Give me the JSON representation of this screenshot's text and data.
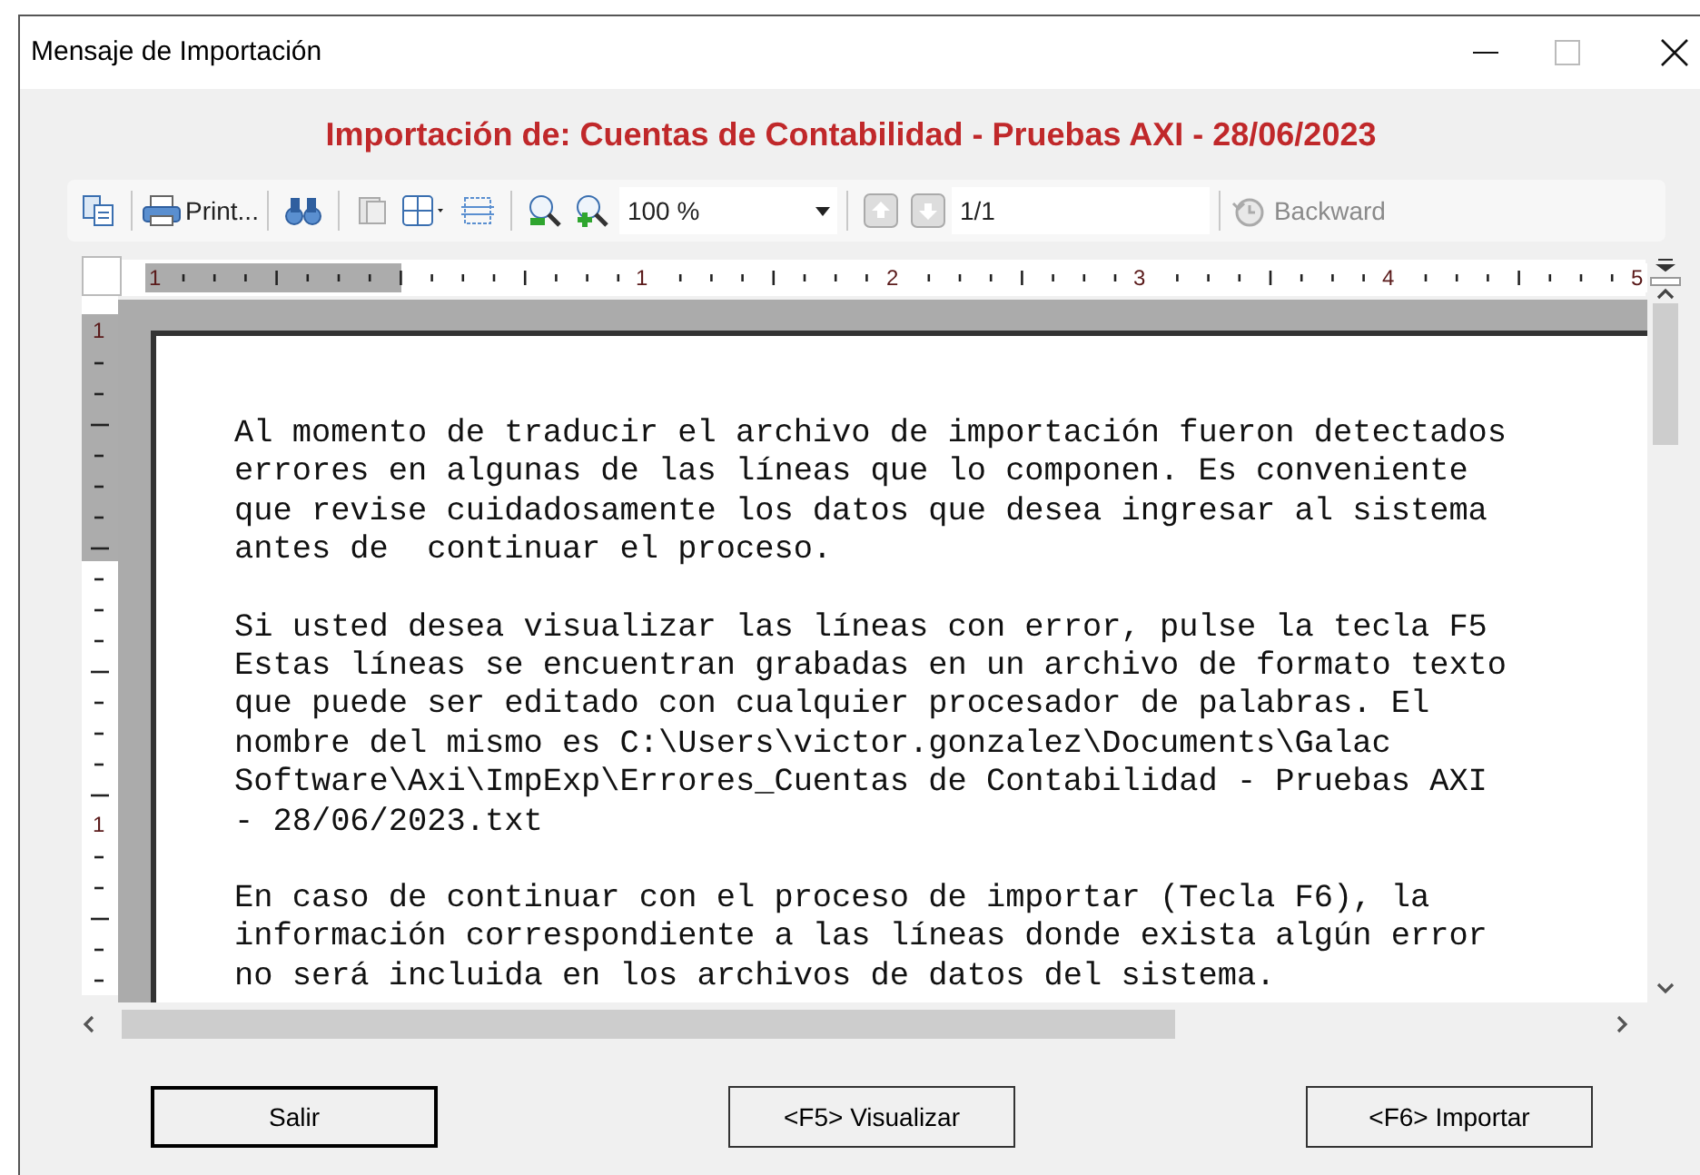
{
  "window": {
    "title": "Mensaje de Importación"
  },
  "heading": "Importación de: Cuentas de Contabilidad - Pruebas AXI - 28/06/2023",
  "toolbar": {
    "print_label": "Print...",
    "zoom": "100 %",
    "page": "1/1",
    "backward": {
      "label": "Backward",
      "disabled": true
    }
  },
  "ruler": {
    "horizontal_labels": [
      "1",
      "1",
      "2",
      "3",
      "4",
      "5"
    ],
    "vertical_labels": [
      "1",
      "1"
    ]
  },
  "document": {
    "paragraphs": [
      [
        "Al momento de traducir el archivo de importación fueron detectados",
        "errores en algunas de las líneas que lo componen. Es conveniente",
        "que revise cuidadosamente los datos que desea ingresar al sistema",
        "antes de  continuar el proceso."
      ],
      [
        "Si usted desea visualizar las líneas con error, pulse la tecla F5",
        "Estas líneas se encuentran grabadas en un archivo de formato texto",
        "que puede ser editado con cualquier procesador de palabras. El",
        "nombre del mismo es C:\\Users\\victor.gonzalez\\Documents\\Galac",
        "Software\\Axi\\ImpExp\\Errores_Cuentas de Contabilidad - Pruebas AXI",
        "- 28/06/2023.txt"
      ],
      [
        "En caso de continuar con el proceso de importar (Tecla F6), la",
        "información correspondiente a las líneas donde exista algún error",
        "no será incluida en los archivos de datos del sistema."
      ]
    ]
  },
  "buttons": [
    {
      "label": "Salir",
      "default": true
    },
    {
      "label": "<F5> Visualizar",
      "default": false
    },
    {
      "label": "<F6> Importar",
      "default": false
    }
  ]
}
